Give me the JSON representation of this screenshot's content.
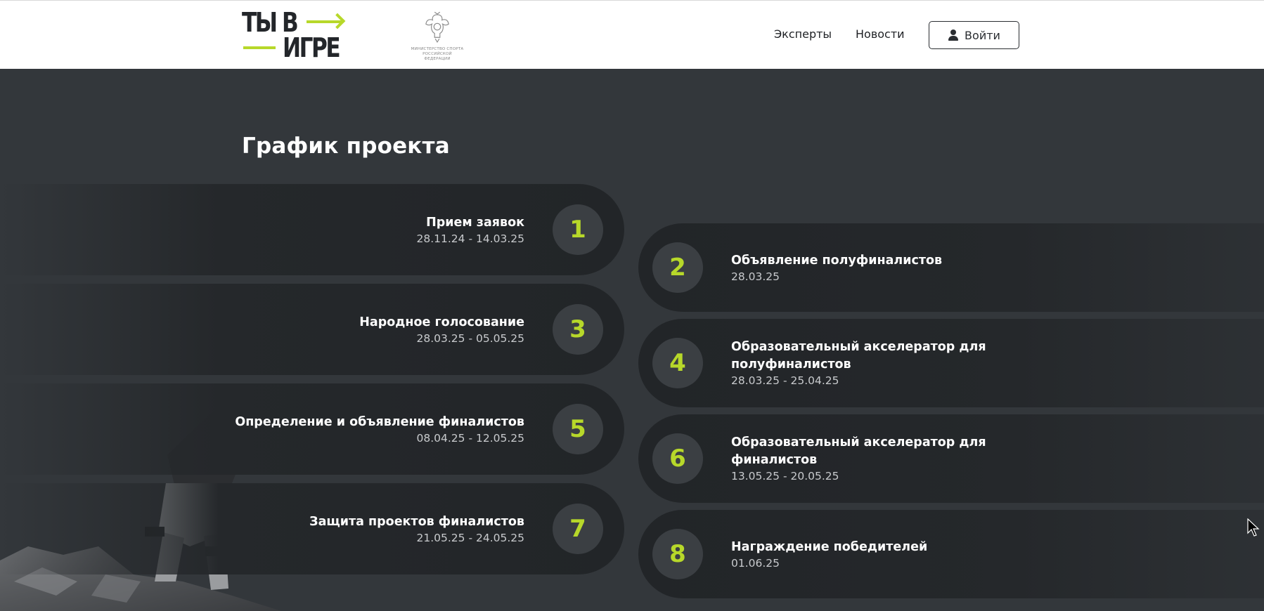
{
  "header": {
    "logo": {
      "line1": "ТЫ В",
      "line2": "ИГРЕ",
      "accent": "#b7d82a"
    },
    "ministry": {
      "icon": "emblem-icon",
      "text": "МИНИСТЕРСТВО СПОРТА\nРОССИЙСКОЙ ФЕДЕРАЦИИ"
    },
    "nav": [
      {
        "label": "Эксперты"
      },
      {
        "label": "Новости"
      }
    ],
    "login": {
      "label": "Войти",
      "icon": "user-icon"
    }
  },
  "main": {
    "title": "График проекта",
    "steps": [
      {
        "num": "1",
        "title": "Прием заявок",
        "date": "28.11.24 - 14.03.25"
      },
      {
        "num": "2",
        "title": "Объявление полуфиналистов",
        "date": "28.03.25"
      },
      {
        "num": "3",
        "title": "Народное голосование",
        "date": "28.03.25 - 05.05.25"
      },
      {
        "num": "4",
        "title": "Образовательный акселератор для полуфиналистов",
        "date": "28.03.25 - 25.04.25"
      },
      {
        "num": "5",
        "title": "Определение и объявление финалистов",
        "date": "08.04.25 - 12.05.25"
      },
      {
        "num": "6",
        "title": "Образовательный акселератор для финалистов",
        "date": "13.05.25 - 20.05.25"
      },
      {
        "num": "7",
        "title": "Защита проектов финалистов",
        "date": "21.05.25 - 24.05.25"
      },
      {
        "num": "8",
        "title": "Награждение победителей",
        "date": "01.06.25"
      }
    ]
  },
  "colors": {
    "background": "#33373b",
    "accent": "#b7d82a",
    "pill": "#222528",
    "header": "#ffffff"
  }
}
